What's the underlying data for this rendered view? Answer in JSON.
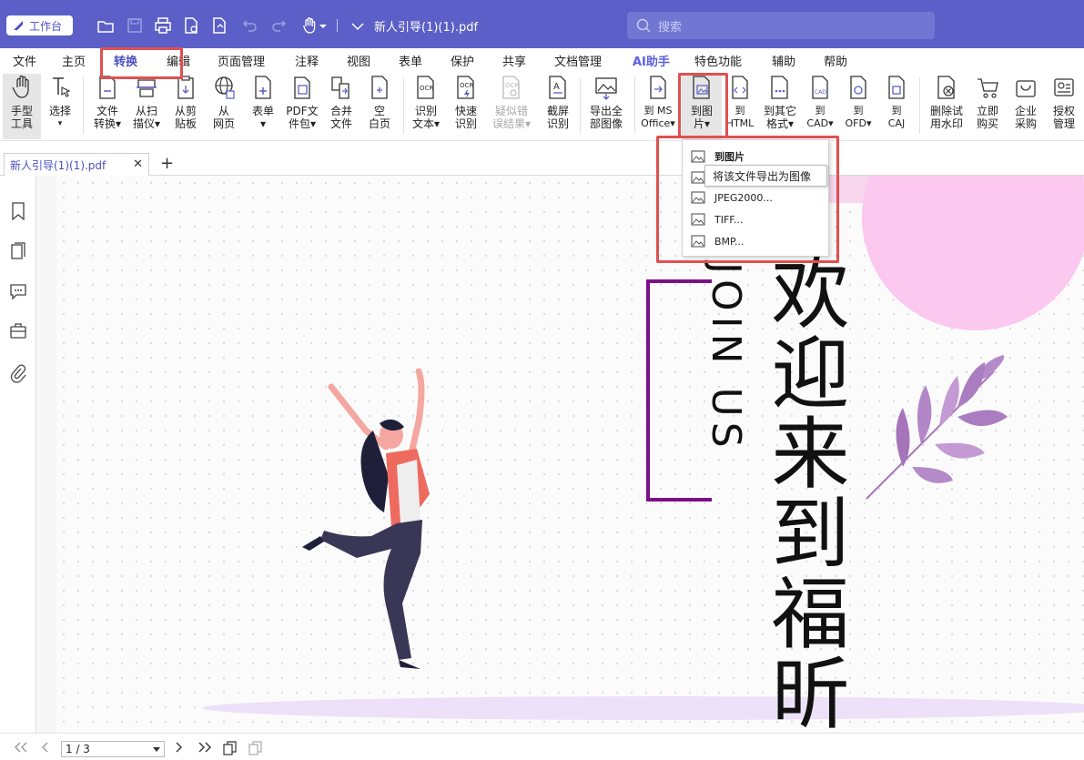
{
  "titlebar": {
    "workbench_label": "工作台",
    "doc_title": "新人引导(1)(1).pdf",
    "search_placeholder": "搜索",
    "icons": [
      "open-folder-icon",
      "save-icon",
      "print-icon",
      "file-settings-icon",
      "undo-icon",
      "redo-icon",
      "hand-icon",
      "dropdown-chevron-icon"
    ]
  },
  "menu": [
    "文件",
    "主页",
    "转换",
    "编辑",
    "页面管理",
    "注释",
    "视图",
    "表单",
    "保护",
    "共享",
    "文档管理",
    "AI助手",
    "特色功能",
    "辅助",
    "帮助"
  ],
  "active_menu": "转换",
  "ribbon": {
    "hand_tool": "手型\n工具",
    "select": "选择",
    "file_convert": "文件\n转换▾",
    "from_scanner": "从扫\n描仪▾",
    "from_clipboard": "从剪\n贴板",
    "from_web": "从\n网页",
    "form": "表单\n▾",
    "pdf_package": "PDF文\n件包▾",
    "merge": "合并\n文件",
    "blank_page": "空\n白页",
    "ocr_text": "识别\n文本▾",
    "quick_ocr": "快速\n识别",
    "suspect_ocr": "疑似错\n误结果▾",
    "screenshot_ocr": "截屏\n识别",
    "export_images": "导出全\n部图像",
    "to_ms_office": "到 MS\nOffice▾",
    "to_image": "到图\n片▾",
    "to_html": "到\nHTML",
    "to_other": "到其它\n格式▾",
    "to_cad": "到\nCAD▾",
    "to_ofd": "到\nOFD▾",
    "to_caj": "到\nCAJ",
    "remove_watermark": "删除试\n用水印",
    "buy_now": "立即\n购买",
    "enterprise": "企业\n采购",
    "license": "授权\n管理"
  },
  "tabs": {
    "doc_tab": "新人引导(1)(1).pdf",
    "close": "✕",
    "add": "+"
  },
  "dropdown": {
    "items": [
      "到图片",
      "JPEG2000...",
      "TIFF...",
      "BMP..."
    ],
    "tooltip": "将该文件导出为图像"
  },
  "document": {
    "vertical_en": "JOIN US",
    "vertical_zh": "欢迎来到福昕"
  },
  "bottom": {
    "page_indicator": "1 / 3"
  },
  "colors": {
    "brand": "#5b5fc7",
    "accent_purple": "#7b1186",
    "annotation_red": "#e05050",
    "pink": "#fbc8f0"
  }
}
